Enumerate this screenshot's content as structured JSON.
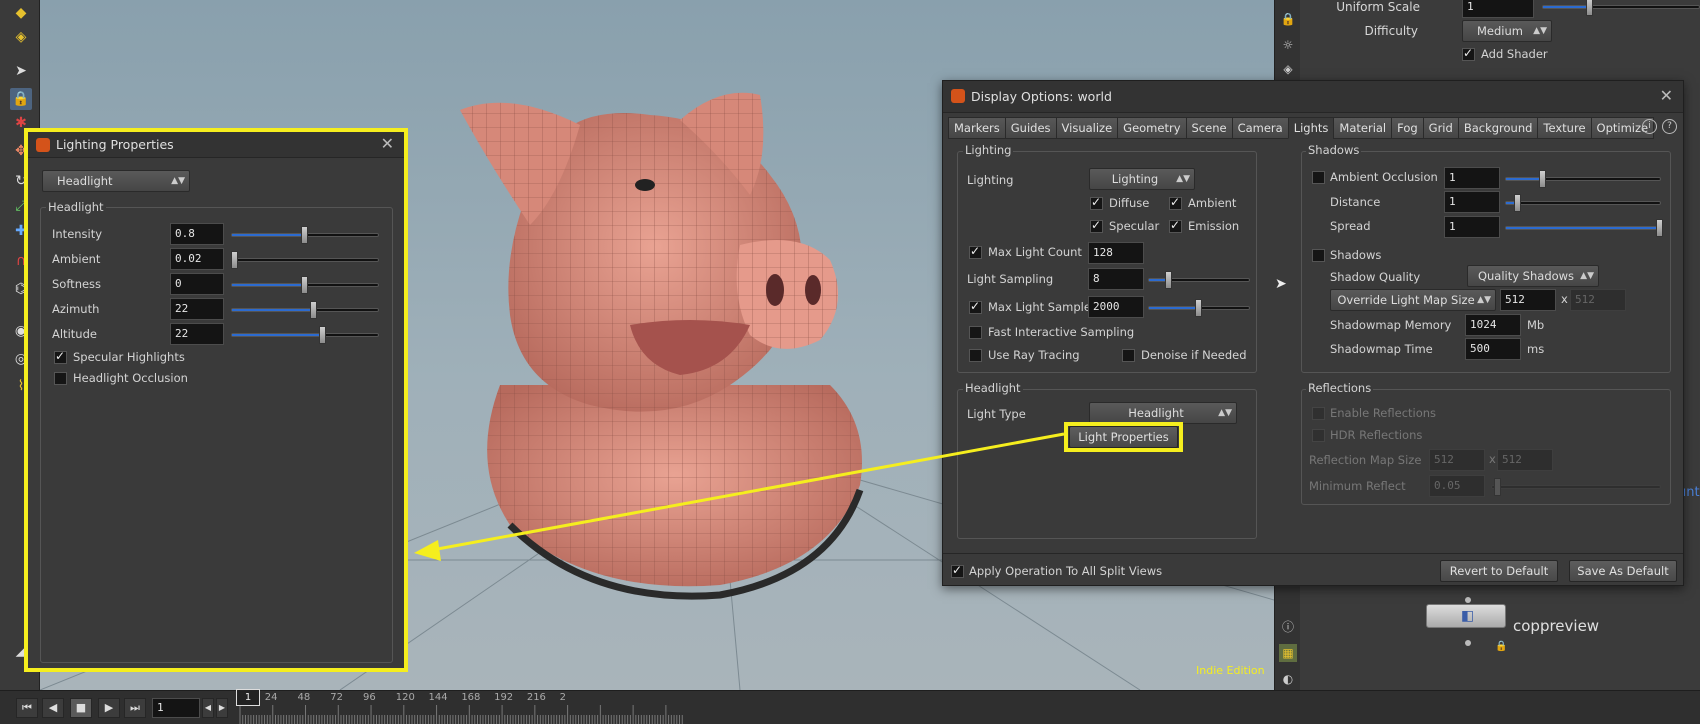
{
  "right_panel": {
    "uniform_scale_label": "Uniform Scale",
    "uniform_scale_value": "1",
    "uniform_scale_level": 0.3,
    "difficulty_label": "Difficulty",
    "difficulty_value": "Medium",
    "add_shader_label": "Add Shader",
    "add_shader_checked": true,
    "node_label": "coppreview",
    "partial_text": "unt"
  },
  "viewport": {
    "watermark": "Indie Edition"
  },
  "display_options": {
    "title": "Display Options:  world",
    "tabs": [
      "Markers",
      "Guides",
      "Visualize",
      "Geometry",
      "Scene",
      "Camera",
      "Lights",
      "Material",
      "Fog",
      "Grid",
      "Background",
      "Texture",
      "Optimize"
    ],
    "active_tab": "Lights",
    "lighting": {
      "section_title": "Lighting",
      "lighting_label": "Lighting",
      "lighting_mode": "Lighting",
      "diffuse_label": "Diffuse",
      "ambient_label": "Ambient",
      "specular_label": "Specular",
      "emission_label": "Emission",
      "max_light_count_label": "Max Light Count",
      "max_light_count_value": "128",
      "light_sampling_label": "Light Sampling",
      "light_sampling_value": "8",
      "light_sampling_level": 0.2,
      "max_light_samples_label": "Max Light Samples",
      "max_light_samples_value": "2000",
      "max_light_samples_level": 0.5,
      "fast_interactive_label": "Fast Interactive Sampling",
      "use_ray_tracing_label": "Use Ray Tracing",
      "denoise_label": "Denoise if Needed"
    },
    "shadows": {
      "section_title": "Shadows",
      "ambient_occlusion_label": "Ambient Occlusion",
      "ambient_occlusion_value": "1",
      "ambient_occlusion_level": 0.24,
      "distance_label": "Distance",
      "distance_value": "1",
      "distance_level": 0.08,
      "spread_label": "Spread",
      "spread_value": "1",
      "spread_level": 1.0,
      "shadows_label": "Shadows",
      "shadow_quality_label": "Shadow Quality",
      "shadow_quality_value": "Quality Shadows",
      "override_label": "Override Light Map Size",
      "override_w": "512",
      "x_sep": "x",
      "override_h": "512",
      "shadowmap_memory_label": "Shadowmap Memory",
      "shadowmap_memory_value": "1024",
      "shadowmap_memory_unit": "Mb",
      "shadowmap_time_label": "Shadowmap Time",
      "shadowmap_time_value": "500",
      "shadowmap_time_unit": "ms"
    },
    "headlight": {
      "section_title": "Headlight",
      "light_type_label": "Light Type",
      "light_type_value": "Headlight",
      "light_properties_button": "Light Properties"
    },
    "reflections": {
      "section_title": "Reflections",
      "enable_label": "Enable Reflections",
      "hdr_label": "HDR Reflections",
      "map_size_label": "Reflection Map Size",
      "map_w": "512",
      "x_sep": "x",
      "map_h": "512",
      "min_reflect_label": "Minimum Reflect",
      "min_reflect_value": "0.05"
    },
    "apply_label": "Apply Operation To All Split Views",
    "revert_button": "Revert to Default",
    "save_button": "Save As Default"
  },
  "lighting_properties": {
    "title": "Lighting Properties",
    "light_select": "Headlight",
    "section_title": "Headlight",
    "intensity_label": "Intensity",
    "intensity_value": "0.8",
    "intensity_level": 0.5,
    "ambient_label": "Ambient",
    "ambient_value": "0.02",
    "ambient_level": 0.02,
    "softness_label": "Softness",
    "softness_value": "0",
    "softness_level": 0.5,
    "azimuth_label": "Azimuth",
    "azimuth_value": "22",
    "azimuth_level": 0.56,
    "altitude_label": "Altitude",
    "altitude_value": "22",
    "altitude_level": 0.62,
    "specular_label": "Specular Highlights",
    "occlusion_label": "Headlight Occlusion"
  },
  "timeline": {
    "frame_value": "1",
    "current_frame": "1",
    "ticks": [
      "24",
      "48",
      "72",
      "96",
      "120",
      "144",
      "168",
      "192",
      "216",
      "2"
    ]
  },
  "colors": {
    "highlight": "#f5ee1e",
    "slider_fill": "#2c6bd0",
    "houdini_orange": "#d4531a"
  }
}
